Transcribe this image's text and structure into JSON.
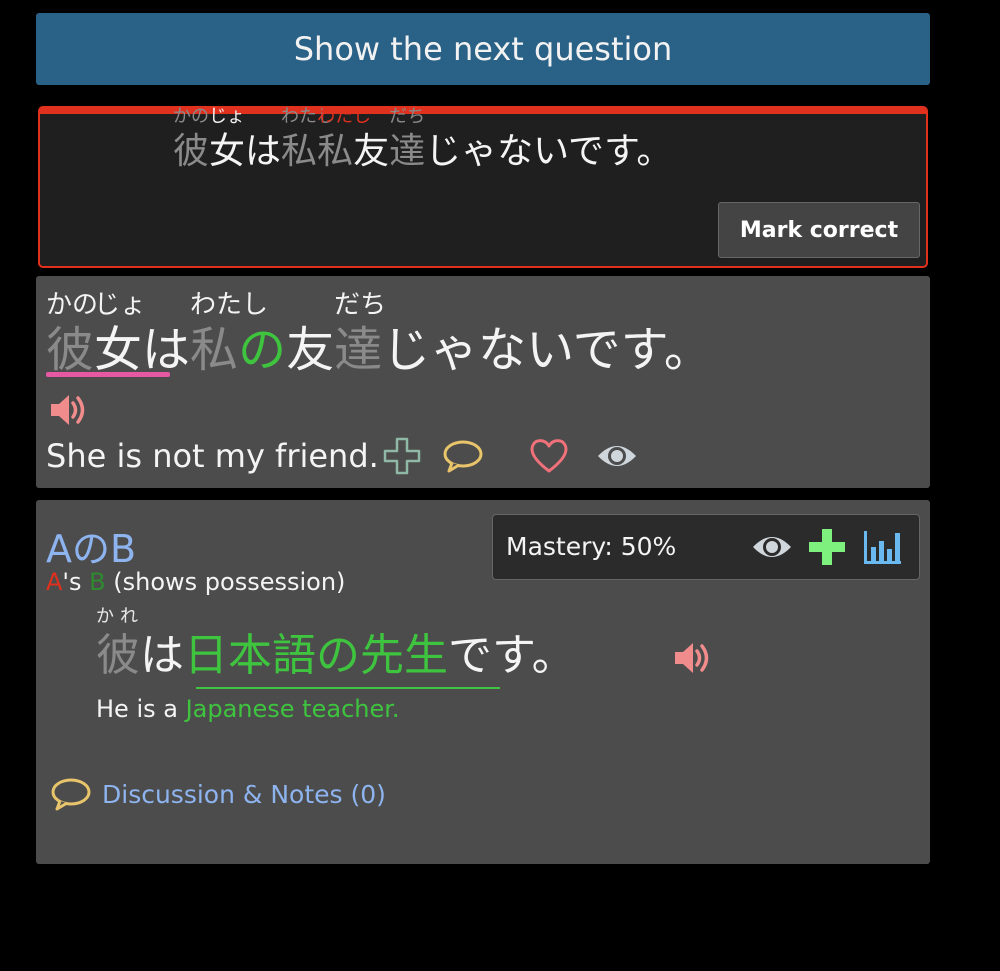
{
  "next_button": {
    "label": "Show the next question"
  },
  "answer": {
    "segments": [
      {
        "text": "彼",
        "ruby": "かの",
        "color": "gray"
      },
      {
        "text": "女",
        "ruby": "じょ",
        "color": "white"
      },
      {
        "text": "は",
        "ruby": "",
        "color": "white"
      },
      {
        "text": " 私 ",
        "ruby": "わたし",
        "color": "gray"
      },
      {
        "text": " 私 ",
        "ruby": "わたし",
        "color": "gray",
        "ruby_color": "red"
      },
      {
        "text": "友",
        "ruby": "",
        "color": "white"
      },
      {
        "text": "達",
        "ruby": "だち",
        "color": "gray"
      },
      {
        "text": "じゃないです。",
        "ruby": "",
        "color": "white"
      }
    ],
    "mark_correct_label": "Mark correct"
  },
  "question": {
    "segments": [
      {
        "text": "彼",
        "ruby": "かの",
        "color": "gray"
      },
      {
        "text": "女",
        "ruby": "じょ",
        "color": "white"
      },
      {
        "text": "は",
        "ruby": "",
        "color": "white"
      },
      {
        "text": " 私 ",
        "ruby": "わたし",
        "color": "gray"
      },
      {
        "text": "の",
        "ruby": "",
        "color": "green"
      },
      {
        "text": "友",
        "ruby": "",
        "color": "white"
      },
      {
        "text": "達",
        "ruby": "だち",
        "color": "gray"
      },
      {
        "text": "じゃないです。",
        "ruby": "",
        "color": "white"
      }
    ],
    "translation": "She is not my friend.",
    "icons": [
      "speaker-icon",
      "plus-outline-icon",
      "comment-icon",
      "heart-icon",
      "eye-icon"
    ]
  },
  "grammar": {
    "title": "AのB",
    "meaning_a": "A",
    "meaning_s": "'s ",
    "meaning_b": "B",
    "meaning_rest": " (shows possession)",
    "mastery_label": "Mastery: 50%",
    "mastery_percent": 50,
    "example": {
      "kanji_he": "彼",
      "ruby_he": "かれ",
      "particle_wa": "は",
      "highlight": "日本語の先生",
      "ending": "です。"
    },
    "example_translation_plain": "He is a ",
    "example_translation_highlight": "Japanese teacher.",
    "discussion_label": "Discussion & Notes (0)"
  },
  "colors": {
    "button_blue": "#2a6186",
    "error_red": "#e0301e",
    "pink_accent": "#e657a4",
    "green": "#3ec43e",
    "link_blue": "#8eb4f0",
    "card_bg": "#4c4c4c",
    "speaker_pink": "#f08c8c",
    "comment_yellow": "#e8c46a",
    "stats_blue": "#6ab8f0"
  }
}
